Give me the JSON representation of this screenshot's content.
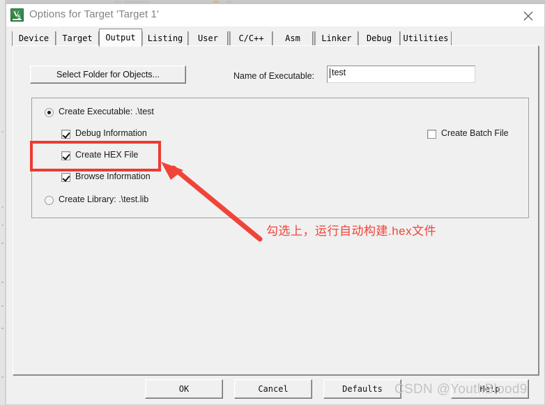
{
  "window": {
    "title": "Options for Target 'Target 1'",
    "icon": "keil-uvision-icon",
    "close_label": "close-icon"
  },
  "tabs": [
    {
      "label": "Device",
      "selected": false
    },
    {
      "label": "Target",
      "selected": false
    },
    {
      "label": "Output",
      "selected": true
    },
    {
      "label": "Listing",
      "selected": false
    },
    {
      "label": "User",
      "selected": false
    },
    {
      "label": "C/C++",
      "selected": false
    },
    {
      "label": "Asm",
      "selected": false
    },
    {
      "label": "Linker",
      "selected": false
    },
    {
      "label": "Debug",
      "selected": false
    },
    {
      "label": "Utilities",
      "selected": false
    }
  ],
  "output_page": {
    "select_folder_button": "Select Folder for Objects...",
    "executable_label": "Name of Executable:",
    "executable_value": "test",
    "create_executable": {
      "label": "Create Executable:  .\\test",
      "checked": true
    },
    "options": [
      {
        "label": "Debug Information",
        "checked": true
      },
      {
        "label": "Create HEX File",
        "checked": true
      },
      {
        "label": "Browse Information",
        "checked": true
      }
    ],
    "create_library": {
      "label": "Create Library:  .\\test.lib",
      "checked": false
    },
    "create_batch_file": {
      "label": "Create Batch File",
      "checked": false
    }
  },
  "footer": {
    "ok": "OK",
    "cancel": "Cancel",
    "defaults": "Defaults",
    "help": "Help"
  },
  "annotations": {
    "note_text": "勾选上，运行自动构建.hex文件",
    "highlight_color": "#ee3a32",
    "arrow_color": "#f04438"
  },
  "watermark": {
    "text": "CSDN @YouthBlood9",
    "color": "#c3c3c3"
  }
}
